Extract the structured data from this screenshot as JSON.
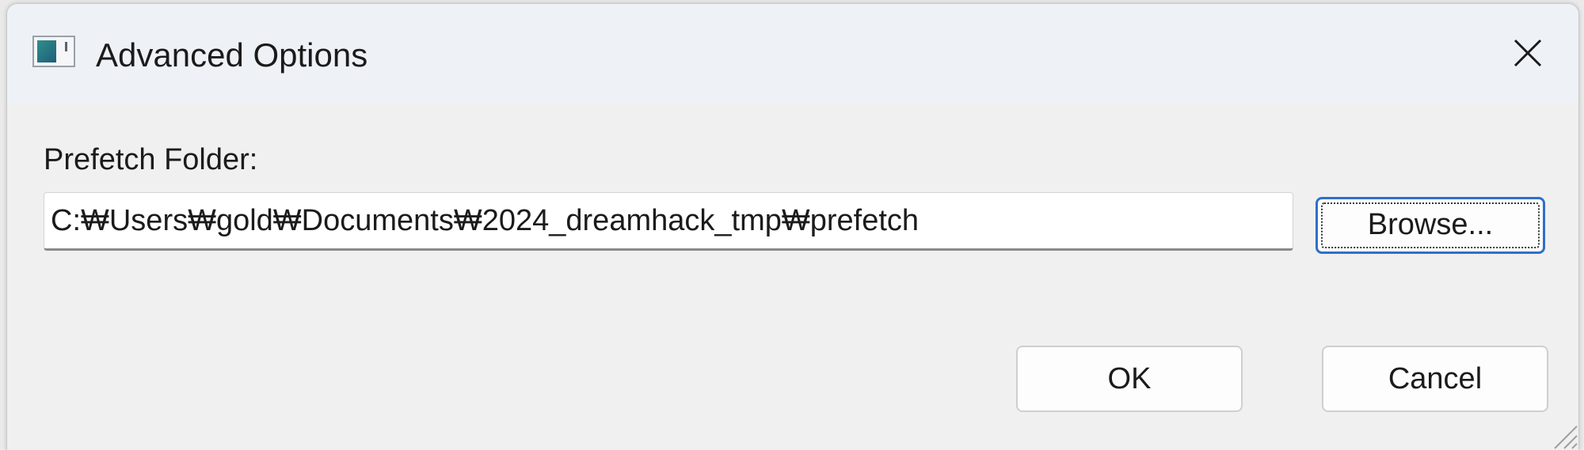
{
  "window": {
    "title": "Advanced Options",
    "app_icon": "application-icon",
    "close_icon": "close-icon"
  },
  "form": {
    "prefetch_label": "Prefetch Folder:",
    "prefetch_path": "C:₩Users₩gold₩Documents₩2024_dreamhack_tmp₩prefetch"
  },
  "buttons": {
    "browse_label": "Browse...",
    "ok_label": "OK",
    "cancel_label": "Cancel"
  },
  "colors": {
    "titlebar": "#eef2f7",
    "body": "#f0f0f0",
    "focus_accent": "#2f6fc9"
  }
}
